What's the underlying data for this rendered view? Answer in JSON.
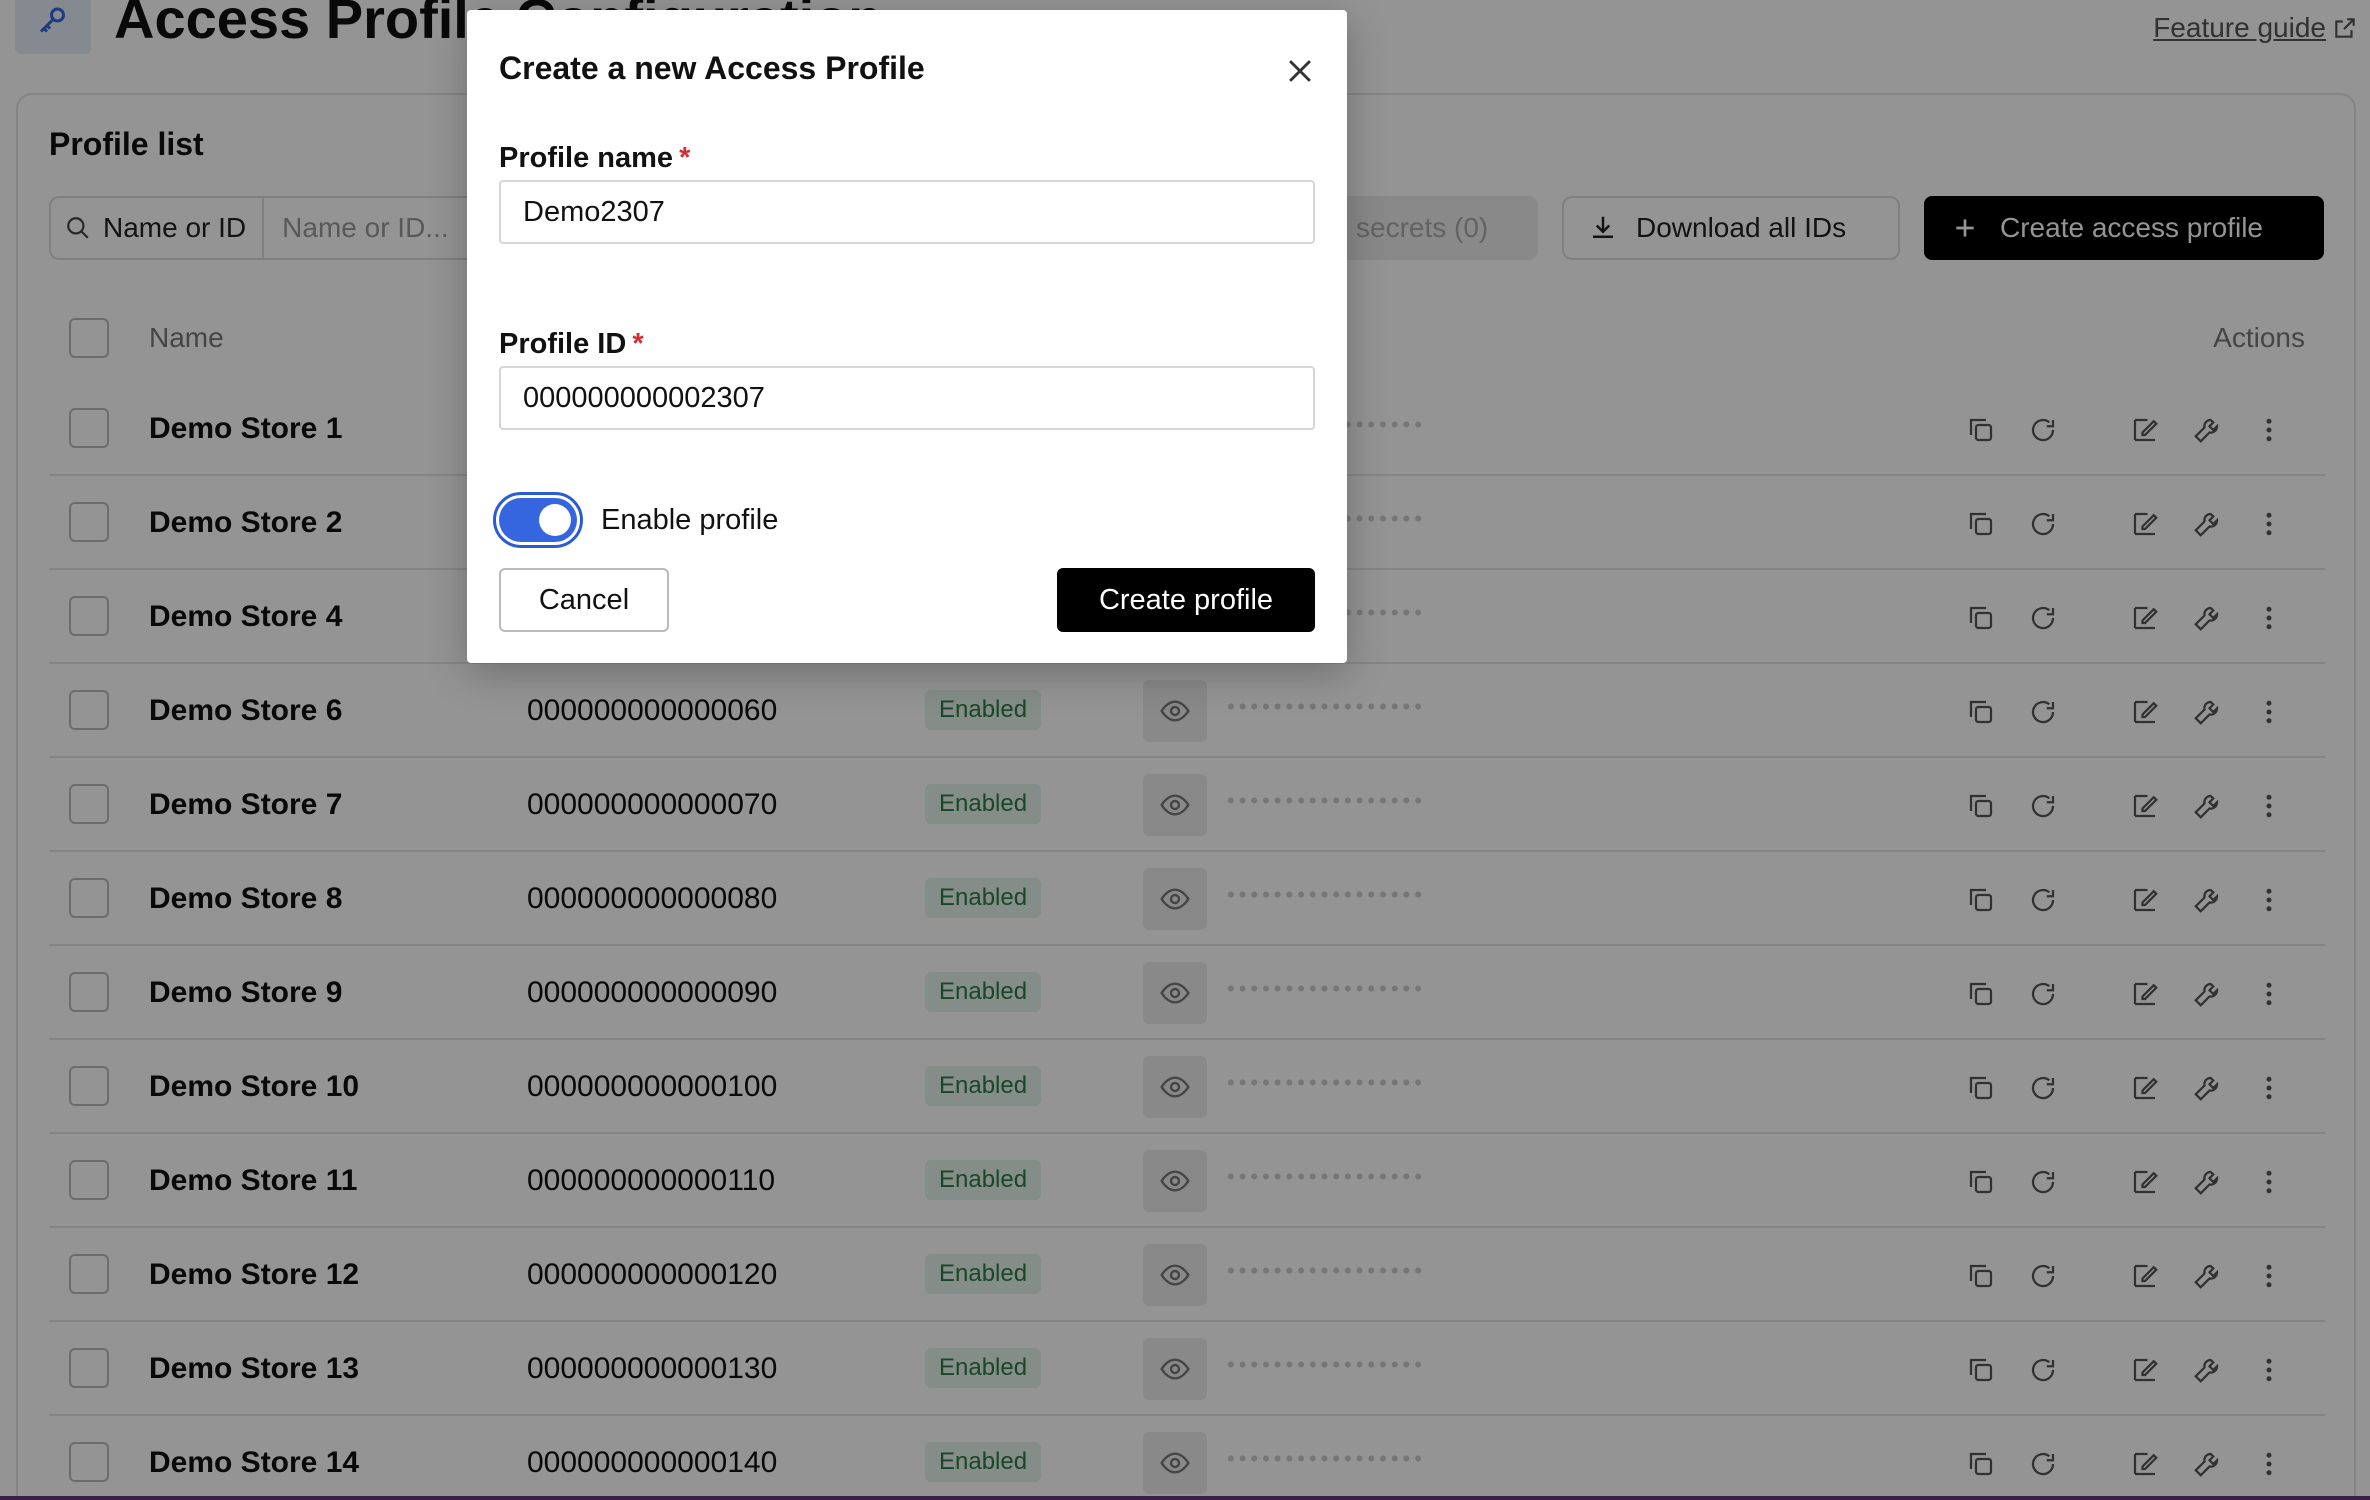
{
  "page": {
    "title": "Access Profile Configuration",
    "feature_guide": "Feature guide"
  },
  "profile_list": {
    "title": "Profile list",
    "search_type": "Name or ID",
    "search_placeholder": "Name or ID...",
    "secrets_button": "secrets (0)",
    "download_button": "Download all IDs",
    "create_button": "Create access profile",
    "columns": {
      "name": "Name",
      "actions": "Actions"
    },
    "rows": [
      {
        "name": "Demo Store 1",
        "id": "",
        "status": "",
        "secret": "•••••••••••••••••"
      },
      {
        "name": "Demo Store 2",
        "id": "",
        "status": "",
        "secret": "•••••••••••••••••"
      },
      {
        "name": "Demo Store 4",
        "id": "",
        "status": "",
        "secret": "•••••••••••••••••"
      },
      {
        "name": "Demo Store 6",
        "id": "000000000000060",
        "status": "Enabled",
        "secret": "•••••••••••••••••"
      },
      {
        "name": "Demo Store 7",
        "id": "000000000000070",
        "status": "Enabled",
        "secret": "•••••••••••••••••"
      },
      {
        "name": "Demo Store 8",
        "id": "000000000000080",
        "status": "Enabled",
        "secret": "•••••••••••••••••"
      },
      {
        "name": "Demo Store 9",
        "id": "000000000000090",
        "status": "Enabled",
        "secret": "•••••••••••••••••"
      },
      {
        "name": "Demo Store 10",
        "id": "000000000000100",
        "status": "Enabled",
        "secret": "•••••••••••••••••"
      },
      {
        "name": "Demo Store 11",
        "id": "000000000000110",
        "status": "Enabled",
        "secret": "•••••••••••••••••"
      },
      {
        "name": "Demo Store 12",
        "id": "000000000000120",
        "status": "Enabled",
        "secret": "•••••••••••••••••"
      },
      {
        "name": "Demo Store 13",
        "id": "000000000000130",
        "status": "Enabled",
        "secret": "•••••••••••••••••"
      },
      {
        "name": "Demo Store 14",
        "id": "000000000000140",
        "status": "Enabled",
        "secret": "•••••••••••••••••"
      }
    ],
    "row_icons": [
      "copy-icon",
      "refresh-icon",
      "edit-icon",
      "wrench-icon",
      "more-vertical-icon"
    ]
  },
  "modal": {
    "title": "Create a new Access Profile",
    "name_label": "Profile name",
    "name_value": "Demo2307",
    "id_label": "Profile ID",
    "id_value": "000000000002307",
    "required_mark": "*",
    "toggle_label": "Enable profile",
    "toggle_on": true,
    "cancel_label": "Cancel",
    "create_label": "Create profile"
  },
  "colors": {
    "accent": "#3566e0",
    "primary_button": "#000000",
    "required": "#d32f2f",
    "enabled_badge_bg": "#e4f3e8",
    "enabled_badge_text": "#2d7a45"
  }
}
